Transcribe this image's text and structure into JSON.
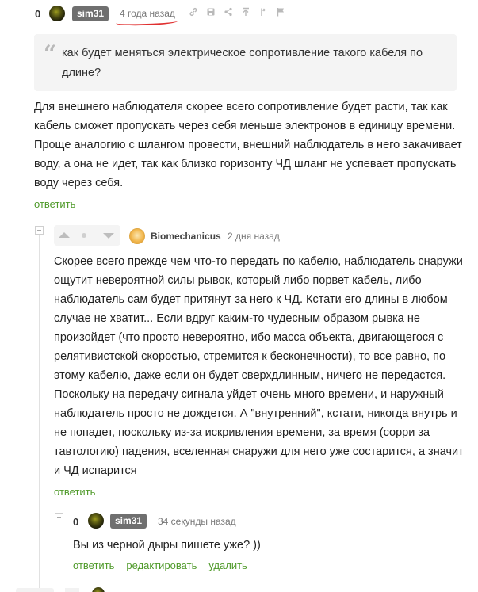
{
  "comment1": {
    "rating": "0",
    "author": "sim31",
    "time": "4 года назад",
    "icons": [
      "link-icon",
      "save-icon",
      "share-icon",
      "scroll-top-icon",
      "branch-icon",
      "flag-icon"
    ],
    "quote": "как будет меняться электрическое сопротивление такого кабеля по длине?",
    "body_lines": [
      "Для внешнего наблюдателя скорее всего сопротивление будет расти, так как",
      "кабель сможет пропускать через себя меньше электронов в единицу времени.",
      "Проще аналогию с шлангом провести, внешний наблюдатель в него закачивает",
      "воду, а она не идет, так как близко горизонту ЧД шланг не успевает пропускать",
      "воду через себя."
    ],
    "reply_label": "ответить"
  },
  "comment2": {
    "author": "Biomechanicus",
    "time": "2 дня назад",
    "body_lines": [
      "Скорее всего прежде чем что-то передать по кабелю, наблюдатель снаружи",
      "ощутит невероятной силы рывок, который либо порвет кабель, либо",
      "наблюдатель сам будет притянут за него к ЧД. Кстати его длины в любом",
      "случае не хватит... Если вдруг каким-то чудесным образом рывка не",
      "произойдет (что просто невероятно, ибо масса объекта, двигающегося с",
      "релятивистской скоростью, стремится к бесконечности), то все равно, по",
      "этому кабелю, даже если он будет сверхдлинным, ничего не передастся.",
      "Поскольку на передачу сигнала уйдет очень много времени, и наружный",
      "наблюдатель просто не дождется. А \"внутренний\", кстати, никогда внутрь и",
      "не попадет, поскольку из-за искривления времени, за время (сорри за",
      "тавтологию) падения, вселенная снаружи для него уже состарится, а значит",
      "и ЧД испарится"
    ],
    "reply_label": "ответить"
  },
  "comment3": {
    "rating": "0",
    "author": "sim31",
    "time": "34 секунды назад",
    "body": "Вы из черной дыры пишете уже? ))",
    "actions": [
      "ответить",
      "редактировать",
      "удалить"
    ]
  },
  "colors": {
    "link_green": "#4f9a2a",
    "badge_gray": "#6f6f6f",
    "annotation_red": "#e03030"
  }
}
